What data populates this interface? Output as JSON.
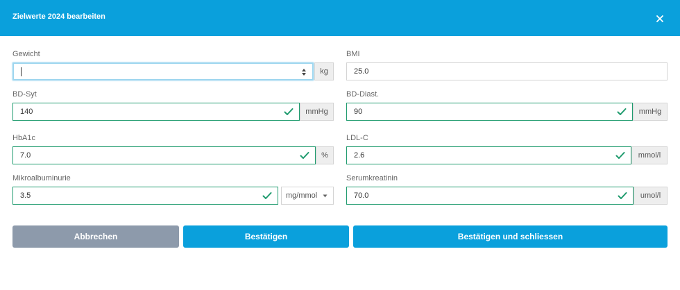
{
  "dialog": {
    "title": "Zielwerte 2024 bearbeiten",
    "close_icon": "close-icon"
  },
  "fields": {
    "gewicht": {
      "label": "Gewicht",
      "value": "",
      "unit": "kg"
    },
    "bmi": {
      "label": "BMI",
      "value": "25.0"
    },
    "bd_syt": {
      "label": "BD-Syt",
      "value": "140",
      "unit": "mmHg"
    },
    "bd_diast": {
      "label": "BD-Diast.",
      "value": "90",
      "unit": "mmHg"
    },
    "hba1c": {
      "label": "HbA1c",
      "value": "7.0",
      "unit": "%"
    },
    "ldl_c": {
      "label": "LDL-C",
      "value": "2.6",
      "unit": "mmol/l"
    },
    "mikroalbuminurie": {
      "label": "Mikroalbuminurie",
      "value": "3.5",
      "unit": "mg/mmol"
    },
    "serumkreatinin": {
      "label": "Serumkreatinin",
      "value": "70.0",
      "unit": "umol/l"
    }
  },
  "buttons": {
    "cancel": "Abbrechen",
    "confirm": "Bestätigen",
    "confirm_close": "Bestätigen und schliessen"
  },
  "colors": {
    "header": "#0aa0dc",
    "valid_border": "#1f9b6e",
    "check": "#1f9b6e",
    "cancel_button": "#8d9aab",
    "primary_button": "#0aa0dc"
  }
}
